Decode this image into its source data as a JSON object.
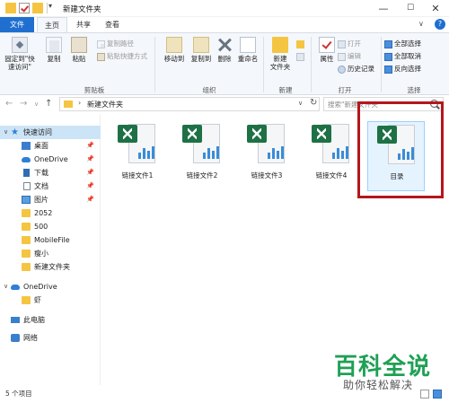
{
  "window": {
    "title": "新建文件夹",
    "minimize": "—",
    "maximize": "☐",
    "close": "✕"
  },
  "tabs": {
    "file": "文件",
    "home": "主页",
    "share": "共享",
    "view": "查看"
  },
  "ribbon": {
    "pin": "固定到\"快\n速访问\"",
    "copy": "复制",
    "paste": "粘贴",
    "copy_path": "复制路径",
    "paste_shortcut": "粘贴快捷方式",
    "clipboard_group": "剪贴板",
    "move_to": "移动到",
    "copy_to": "复制到",
    "delete": "删除",
    "rename": "重命名",
    "organize_group": "组织",
    "new_folder": "新建\n文件夹",
    "new_group": "新建",
    "properties": "属性",
    "open": "打开",
    "edit": "编辑",
    "history": "历史记录",
    "open_group": "打开",
    "select_all": "全部选择",
    "select_none": "全部取消",
    "invert_selection": "反向选择",
    "select_group": "选择"
  },
  "address": {
    "path": "新建文件夹",
    "search_placeholder": "搜索\"新建文件夹\""
  },
  "nav": {
    "quick_access": "快速访问",
    "desktop": "桌面",
    "onedrive_quick": "OneDrive",
    "downloads": "下载",
    "documents": "文档",
    "pictures": "图片",
    "f2052": "2052",
    "f500": "500",
    "mobilefile": "MobileFile",
    "shouxiao": "瘦小",
    "newfolder": "新建文件夹",
    "onedrive": "OneDrive",
    "xia": "虾",
    "this_pc": "此电脑",
    "network": "网络"
  },
  "files": [
    "链接文件1",
    "链接文件2",
    "链接文件3",
    "链接文件4",
    "目录"
  ],
  "status": {
    "count": "5 个项目"
  },
  "watermark": {
    "main": "百科全说",
    "sub": "助你轻松解决"
  }
}
